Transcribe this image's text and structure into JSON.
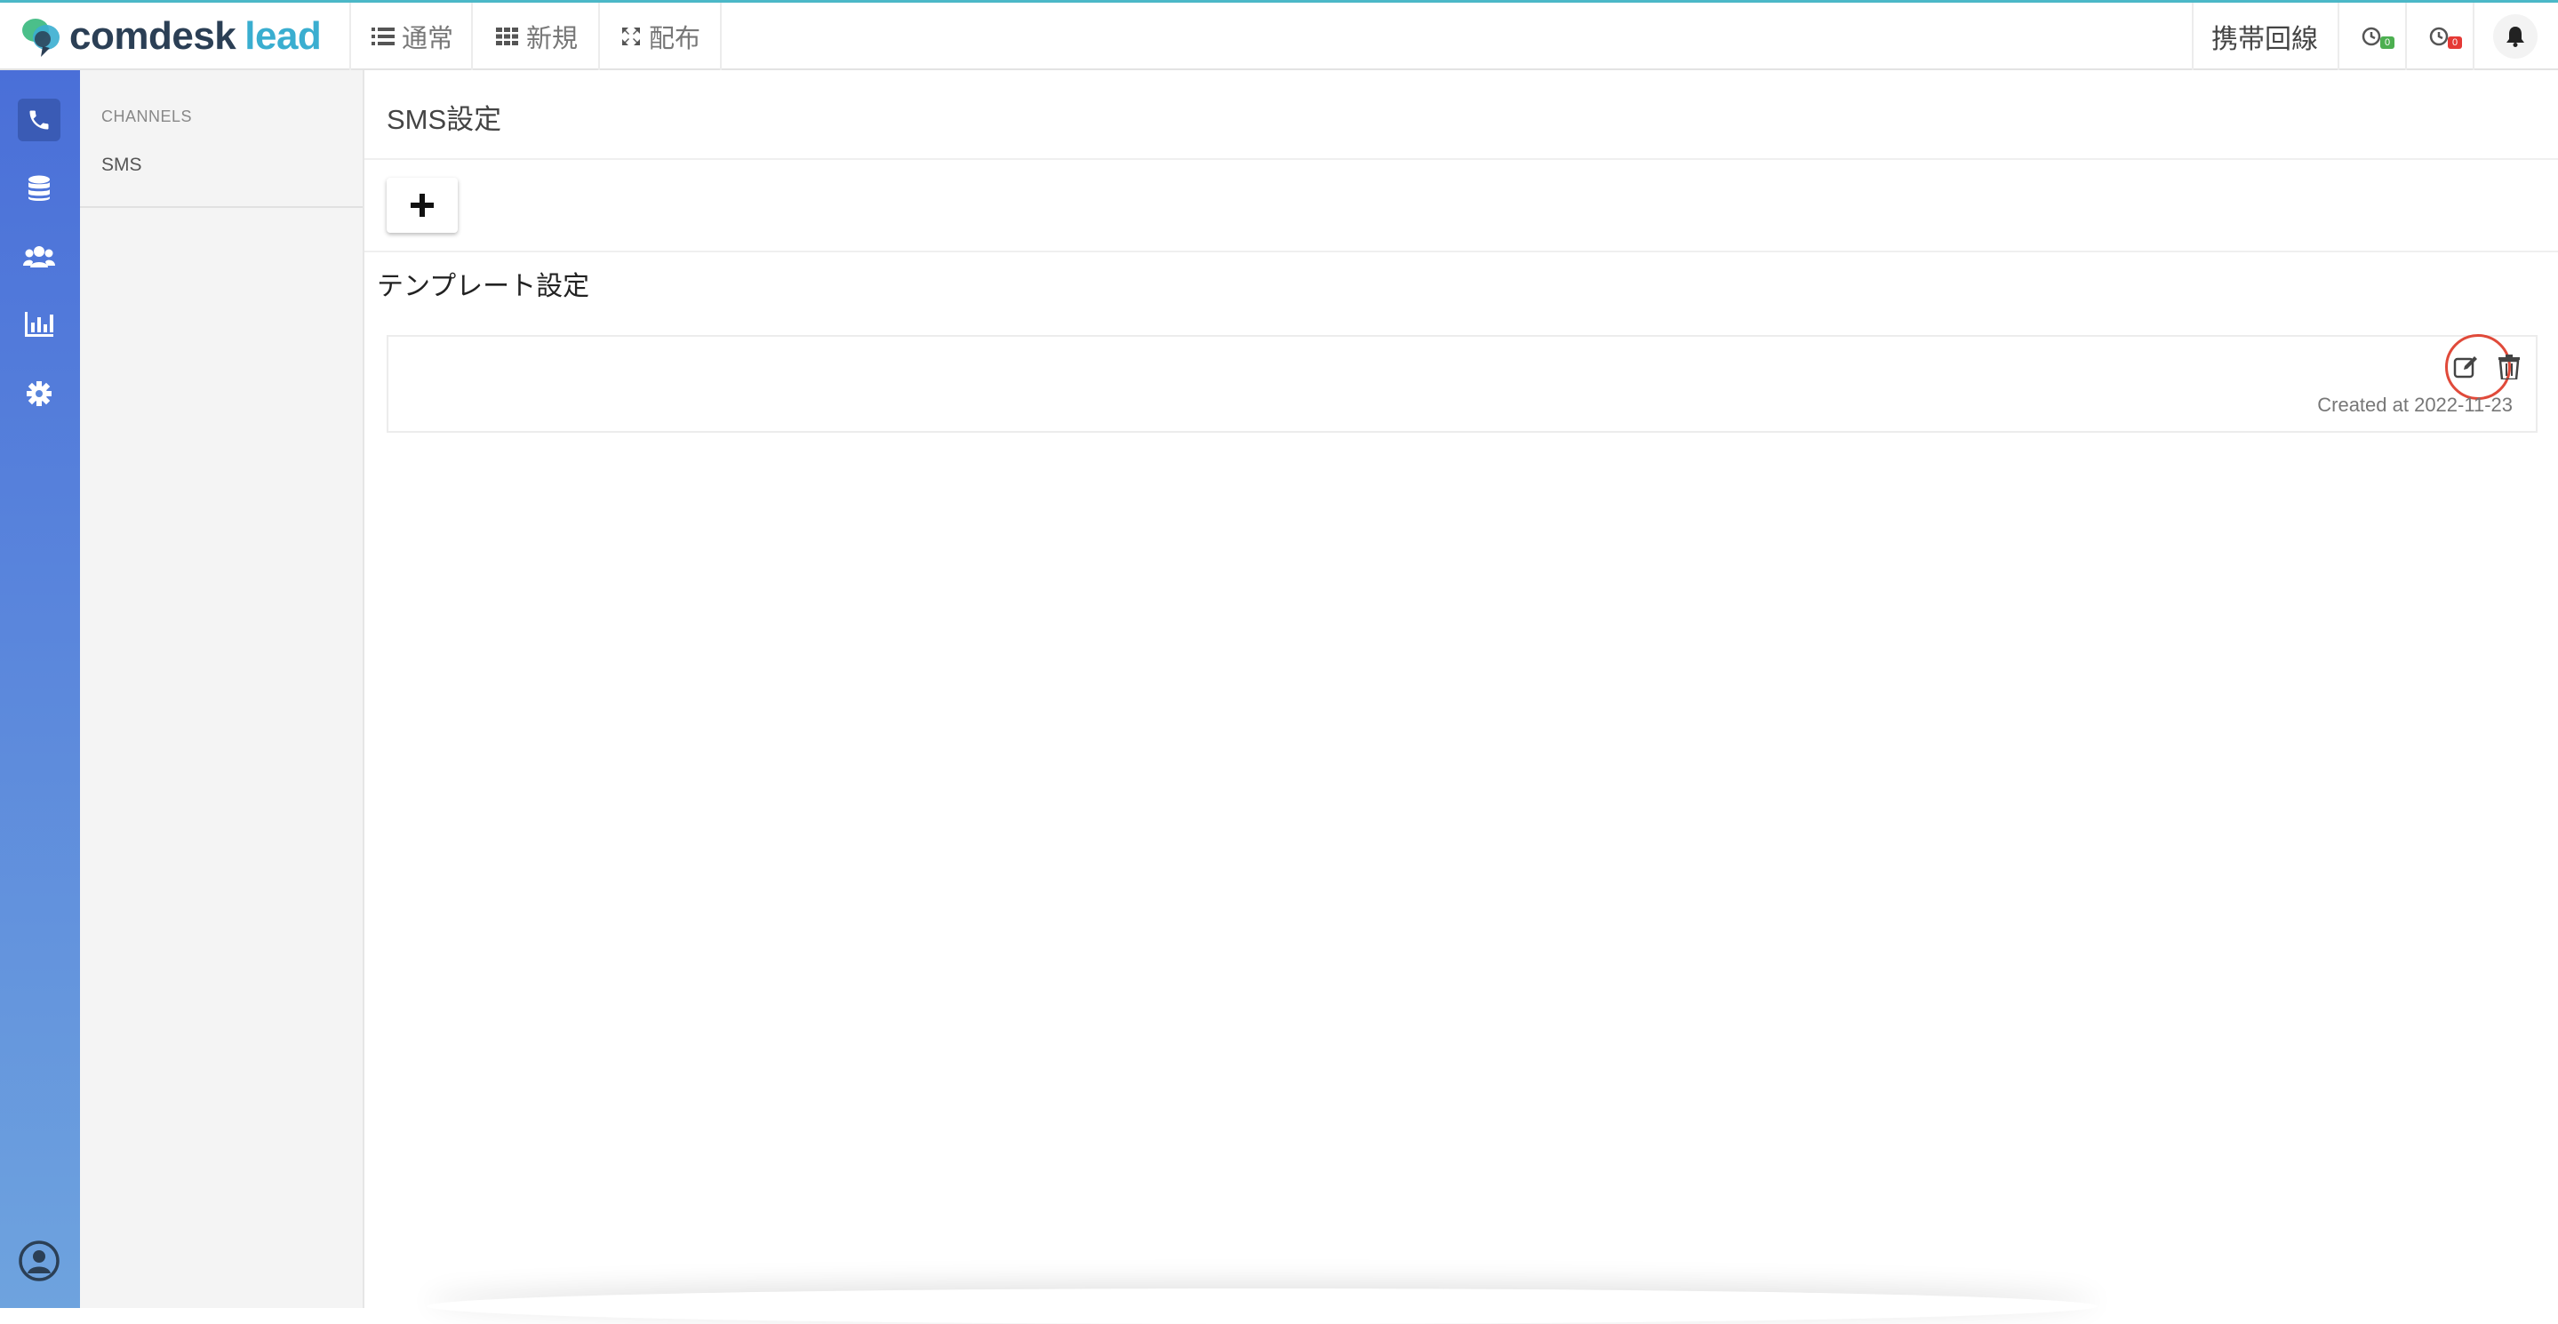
{
  "brand": {
    "name_part1": "comdesk",
    "name_part2": "lead"
  },
  "topnav": {
    "items": [
      {
        "icon": "list-icon",
        "label": "通常"
      },
      {
        "icon": "grid-icon",
        "label": "新規"
      },
      {
        "icon": "expand-arrows-icon",
        "label": "配布"
      }
    ],
    "phone_line": "携帯回線",
    "timer_badge_1": {
      "icon": "timer-icon",
      "count": "0",
      "color": "#4caf50"
    },
    "timer_badge_2": {
      "icon": "timer-icon",
      "count": "0",
      "color": "#e53935"
    },
    "bell_icon": "bell-icon"
  },
  "rail": {
    "items": [
      {
        "icon": "phone-icon",
        "active": true
      },
      {
        "icon": "database-icon",
        "active": false
      },
      {
        "icon": "users-icon",
        "active": false
      },
      {
        "icon": "bar-chart-icon",
        "active": false
      },
      {
        "icon": "gear-icon",
        "active": false
      }
    ],
    "footer_icon": "user-circle-icon"
  },
  "sidebar": {
    "section_title": "CHANNELS",
    "items": [
      {
        "label": "SMS"
      }
    ]
  },
  "main": {
    "page_title": "SMS設定",
    "add_button_icon": "plus-icon",
    "section_title": "テンプレート設定",
    "templates": [
      {
        "created_label": "Created at 2022-11-23",
        "edit_icon": "edit-icon",
        "delete_icon": "trash-icon"
      }
    ]
  },
  "colors": {
    "accent": "#3aaed0",
    "brand_dark": "#2b3f55",
    "rail_top": "#4a6fd8",
    "rail_bottom": "#6ea3de",
    "highlight_ring": "#e04a3a"
  }
}
